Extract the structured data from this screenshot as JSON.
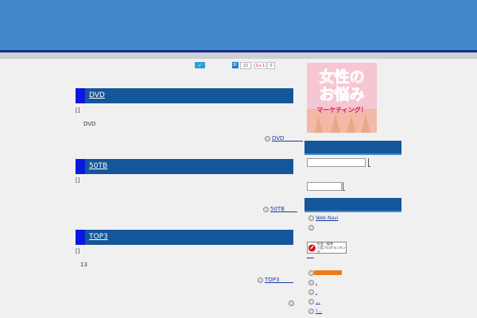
{
  "social": {
    "tweet_label": "✓",
    "hatena_label": "B!",
    "hatena_count": "22",
    "gplus_label": "G+1",
    "gplus_count": "0"
  },
  "entries": [
    {
      "title": "DVD",
      "bracket": "[]",
      "body": "DVD",
      "more": "DVD"
    },
    {
      "title": "50TB",
      "bracket": "[]",
      "body": "",
      "more": "50TB"
    },
    {
      "title": "TOP3",
      "bracket": "[]",
      "body": "13",
      "more": "TOP3"
    }
  ],
  "sidebar": {
    "banner_line1": "女性の",
    "banner_line2": "お悩み",
    "banner_line3": "マーケティング！",
    "links": [
      "Web Navi",
      ""
    ],
    "rank_logo_text_1": "社会・経済",
    "rank_logo_text_2": "人気ブログランキング",
    "rank_link": "___",
    "bottom_links": [
      ".",
      ".",
      "...",
      "!..."
    ]
  },
  "colors": {
    "header": "#4187cb",
    "entry_head": "#14569a",
    "accent": "#0a18e0"
  }
}
